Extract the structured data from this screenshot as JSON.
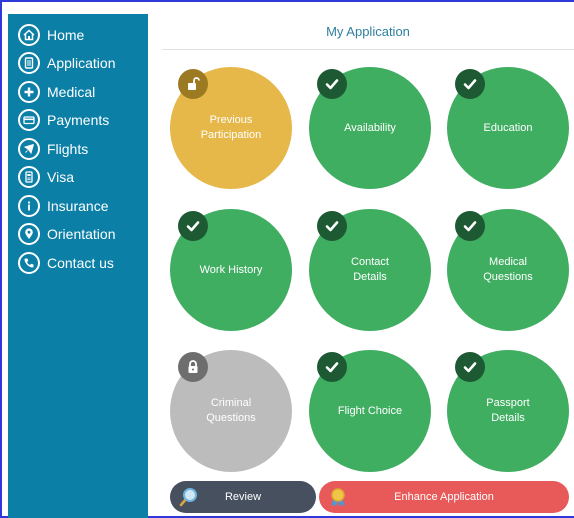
{
  "sidebar": {
    "items": [
      {
        "label": "Home",
        "icon": "home-icon"
      },
      {
        "label": "Application",
        "icon": "document-icon"
      },
      {
        "label": "Medical",
        "icon": "plus-icon"
      },
      {
        "label": "Payments",
        "icon": "card-icon"
      },
      {
        "label": "Flights",
        "icon": "plane-icon"
      },
      {
        "label": "Visa",
        "icon": "visa-doc-icon"
      },
      {
        "label": "Insurance",
        "icon": "info-icon"
      },
      {
        "label": "Orientation",
        "icon": "location-pin-icon"
      },
      {
        "label": "Contact us",
        "icon": "phone-icon"
      }
    ]
  },
  "header": {
    "title": "My Application"
  },
  "tiles": [
    {
      "label": "Previous\nParticipation",
      "status": "unlocked",
      "color": "#e6b84a"
    },
    {
      "label": "Availability",
      "status": "complete",
      "color": "#3fae61"
    },
    {
      "label": "Education",
      "status": "complete",
      "color": "#3fae61"
    },
    {
      "label": "Work History",
      "status": "complete",
      "color": "#3fae61"
    },
    {
      "label": "Contact\nDetails",
      "status": "complete",
      "color": "#3fae61"
    },
    {
      "label": "Medical\nQuestions",
      "status": "complete",
      "color": "#3fae61"
    },
    {
      "label": "Criminal\nQuestions",
      "status": "locked",
      "color": "#bcbcbc"
    },
    {
      "label": "Flight Choice",
      "status": "complete",
      "color": "#3fae61"
    },
    {
      "label": "Passport\nDetails",
      "status": "complete",
      "color": "#3fae61"
    }
  ],
  "buttons": {
    "review": "Review",
    "enhance": "Enhance Application"
  },
  "colors": {
    "sidebar": "#0b7fa6",
    "accent": "#2f7f9f",
    "review_bg": "#46505f",
    "enhance_bg": "#e85a5a"
  }
}
